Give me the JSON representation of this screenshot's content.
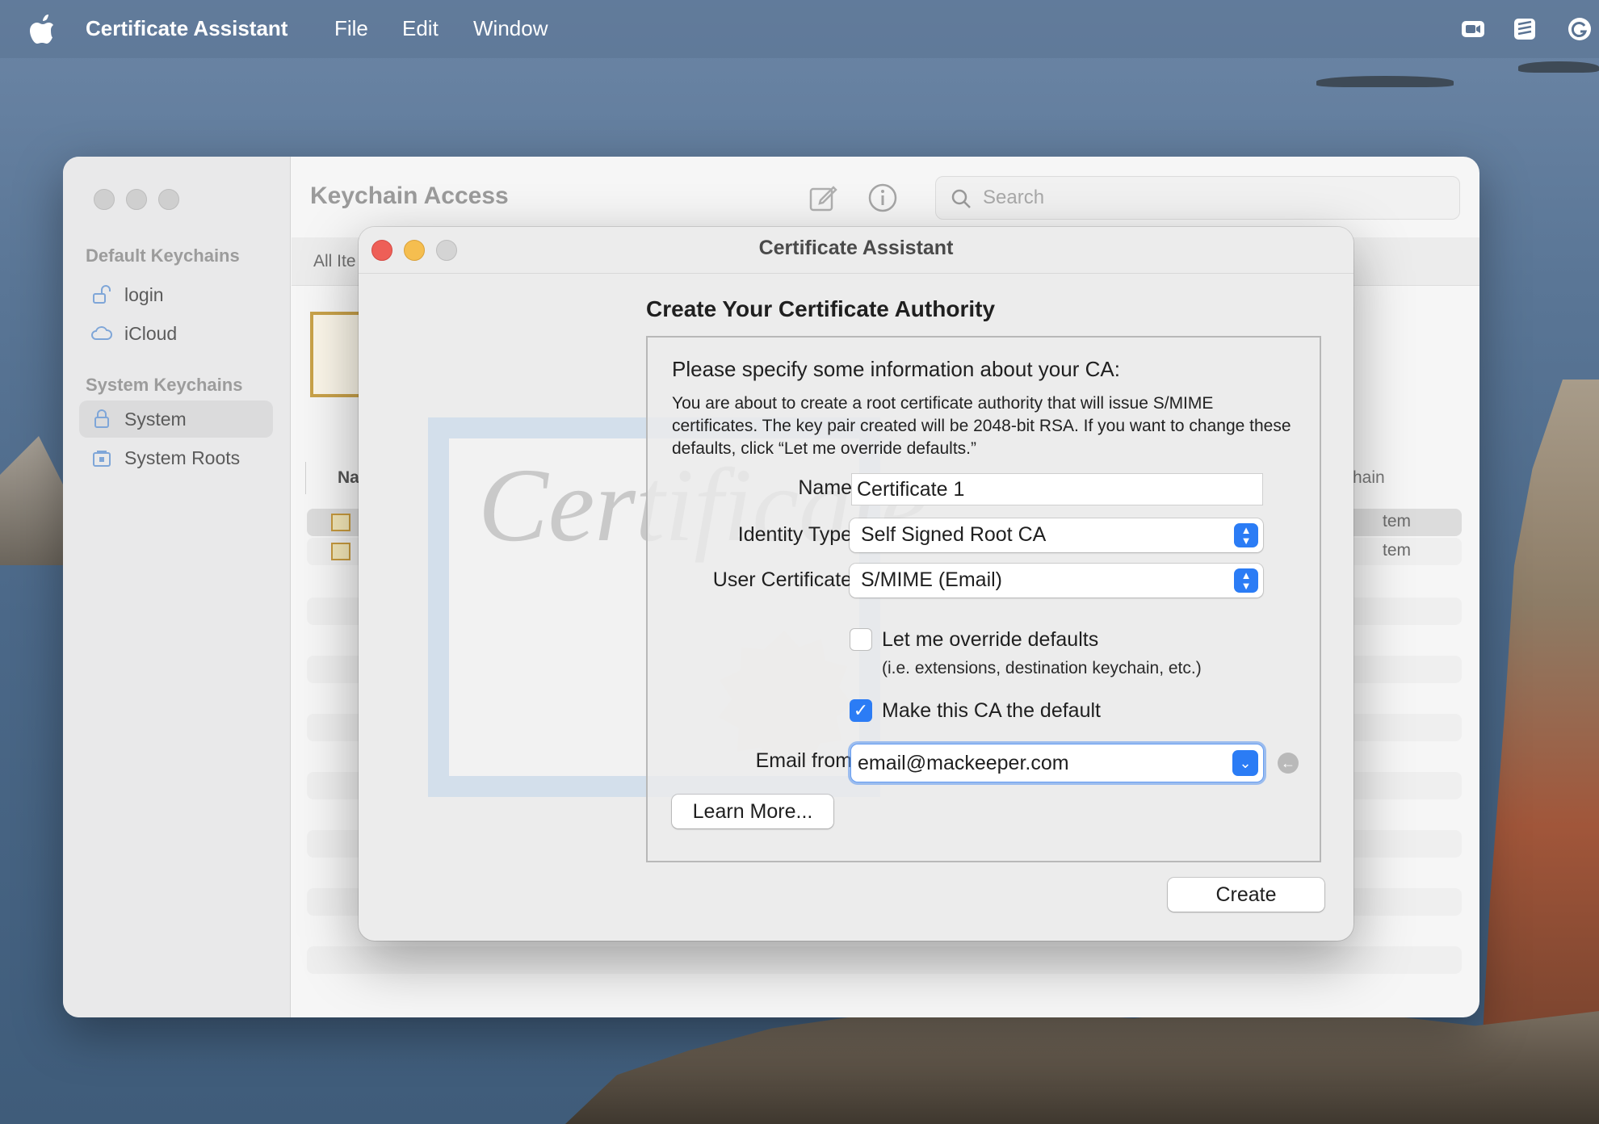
{
  "menubar": {
    "app_name": "Certificate Assistant",
    "menus": [
      "File",
      "Edit",
      "Window"
    ],
    "icons": [
      "apple-icon",
      "facetime-icon",
      "stack-icon",
      "grammarly-icon"
    ]
  },
  "keychain_window": {
    "title": "Keychain Access",
    "search_placeholder": "Search",
    "sidebar": {
      "default_heading": "Default Keychains",
      "default_items": [
        {
          "label": "login",
          "icon": "unlocked-icon"
        },
        {
          "label": "iCloud",
          "icon": "cloud-icon"
        }
      ],
      "system_heading": "System Keychains",
      "system_items": [
        {
          "label": "System",
          "icon": "lock-icon",
          "selected": true
        },
        {
          "label": "System Roots",
          "icon": "lock-cabinet-icon",
          "selected": false
        }
      ]
    },
    "tab_partial": "All Ite",
    "columns": {
      "name_partial": "Na",
      "keychain_partial": "ychain"
    },
    "rows": [
      {
        "keychain_partial": "tem"
      },
      {
        "keychain_partial": "tem"
      }
    ]
  },
  "dialog": {
    "title": "Certificate Assistant",
    "heading": "Create Your Certificate Authority",
    "intro": "Please specify some information about your CA:",
    "description": "You are about to create a root certificate authority that will issue S/MIME certificates. The key pair created will be 2048-bit RSA. If you want to change these defaults, click “Let me override defaults.”",
    "fields": {
      "name_label": "Name:",
      "name_value": "Certificate 1",
      "identity_label": "Identity Type:",
      "identity_value": "Self Signed Root CA",
      "user_cert_label": "User Certificate:",
      "user_cert_value": "S/MIME (Email)",
      "email_label": "Email from:",
      "email_value": "email@mackeeper.com"
    },
    "override": {
      "label": "Let me override defaults",
      "sublabel": "(i.e. extensions, destination keychain, etc.)",
      "checked": false
    },
    "make_default": {
      "label": "Make this CA the default",
      "checked": true
    },
    "learn_more_label": "Learn More...",
    "create_label": "Create",
    "accent_color": "#2b7cf5"
  }
}
